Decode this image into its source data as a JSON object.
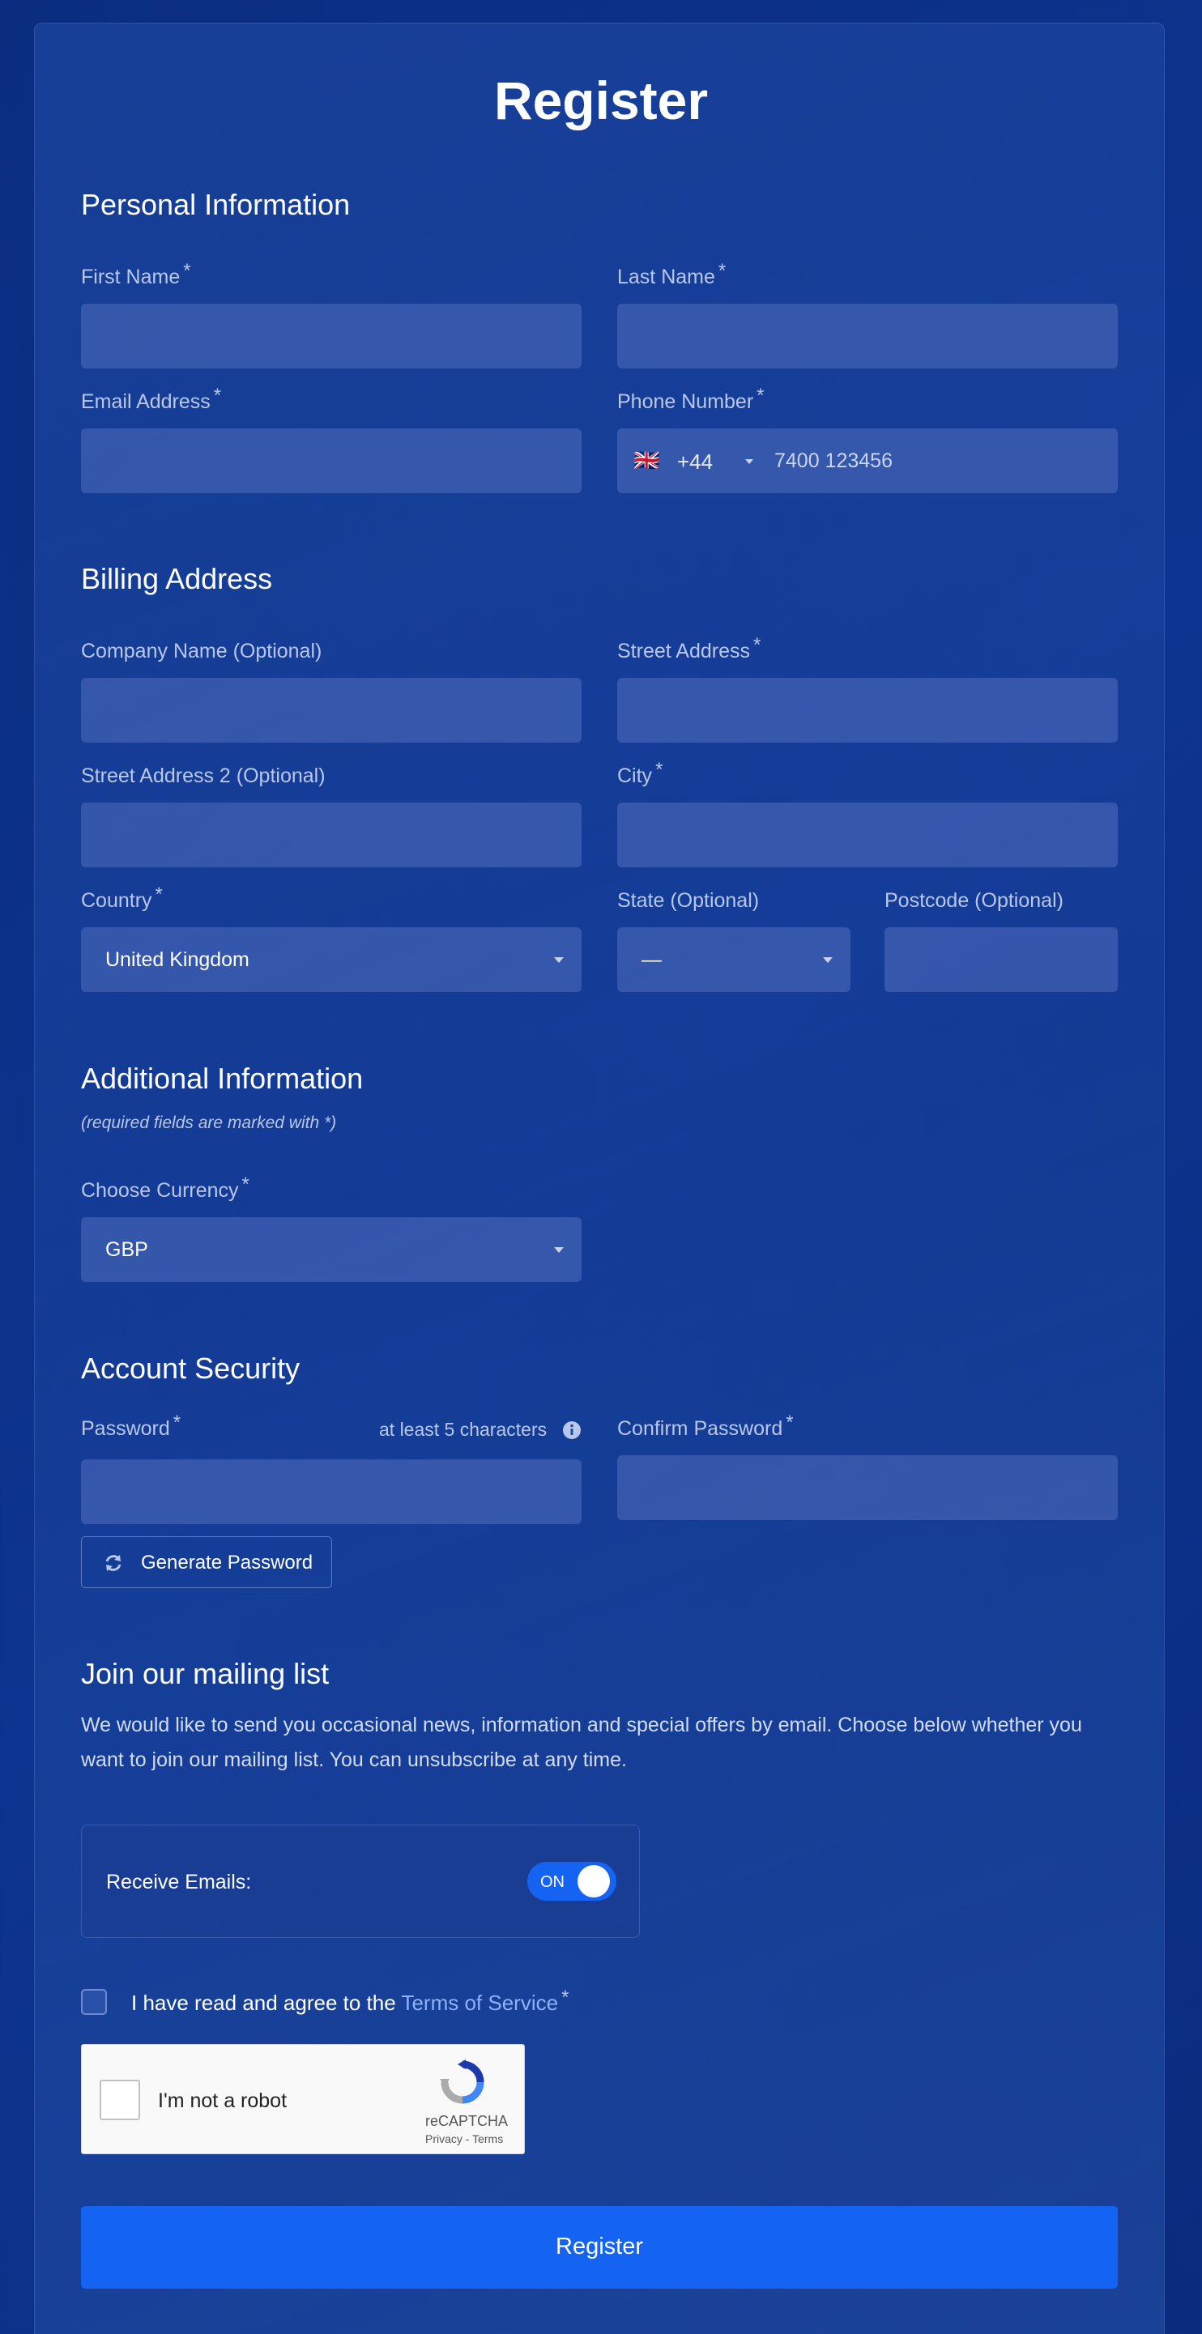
{
  "title": "Register",
  "sections": {
    "personal": "Personal Information",
    "billing": "Billing Address",
    "additional": "Additional Information",
    "security": "Account Security",
    "mailing": "Join our mailing list"
  },
  "required_mark": "*",
  "fields": {
    "first_name": "First Name",
    "last_name": "Last Name",
    "email": "Email Address",
    "phone": "Phone Number",
    "phone_code": "+44",
    "phone_flag": "🇬🇧",
    "phone_placeholder": "7400 123456",
    "company": "Company Name (Optional)",
    "street": "Street Address",
    "street2": "Street Address 2 (Optional)",
    "city": "City",
    "country": "Country",
    "country_value": "United Kingdom",
    "state": "State (Optional)",
    "state_value": "—",
    "postcode": "Postcode (Optional)",
    "currency": "Choose Currency",
    "currency_value": "GBP",
    "password": "Password",
    "password_hint": "at least 5 characters",
    "confirm_password": "Confirm Password"
  },
  "required_note": "(required fields are marked with *)",
  "generate_password": "Generate Password",
  "mailing_text": "We would like to send you occasional news, information and special offers by email. Choose below whether you want to join our mailing list. You can unsubscribe at any time.",
  "receive_emails": "Receive Emails:",
  "toggle_state": "ON",
  "terms_prefix": "I have read and agree to the ",
  "terms_link": "Terms of Service",
  "captcha": {
    "label": "I'm not a robot",
    "brand": "reCAPTCHA",
    "privacy": "Privacy",
    "separator": " - ",
    "terms": "Terms"
  },
  "register_button": "Register",
  "colors": {
    "accent": "#1463f3",
    "background": "#0d3490",
    "link": "#8fb0ff"
  },
  "icons": [
    "refresh-icon",
    "info-icon",
    "caret-down-icon",
    "recaptcha-logo"
  ]
}
